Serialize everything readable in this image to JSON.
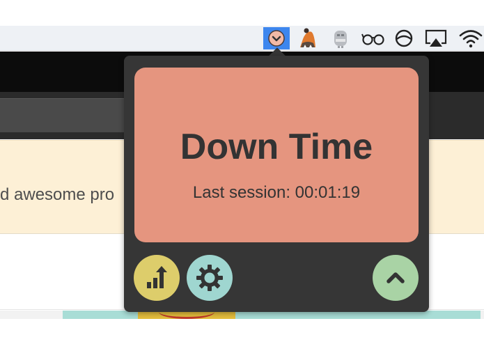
{
  "background_app": {
    "banner_text": "d awesome pro"
  },
  "menubar": {
    "icons": [
      {
        "name": "downtime-menubar-icon",
        "active": true
      },
      {
        "name": "bird-menubar-icon",
        "active": false
      },
      {
        "name": "robot-menubar-icon",
        "active": false
      },
      {
        "name": "glasses-menubar-icon",
        "active": false
      },
      {
        "name": "circle-arc-menubar-icon",
        "active": false
      },
      {
        "name": "airplay-icon",
        "active": false
      },
      {
        "name": "wifi-icon",
        "active": false
      }
    ]
  },
  "popup": {
    "title": "Down Time",
    "last_session_label": "Last session:",
    "last_session_value": "00:01:19",
    "colors": {
      "card": "#e5957f",
      "panel": "#363636",
      "stats_button": "#ddcd6b",
      "settings_button": "#9fd6d0",
      "collapse_button": "#a9d3a5"
    },
    "buttons": [
      {
        "name": "stats-button",
        "icon": "bar-chart-up-icon"
      },
      {
        "name": "settings-button",
        "icon": "gear-icon"
      },
      {
        "name": "collapse-button",
        "icon": "chevron-up-icon"
      }
    ]
  }
}
